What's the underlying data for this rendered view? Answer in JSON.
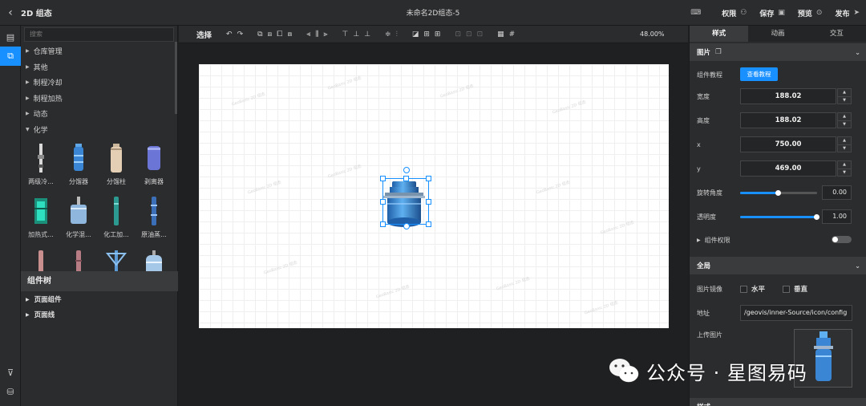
{
  "topbar": {
    "back_icon": "chevron-left-icon",
    "app_title": "2D 组态",
    "doc_title": "未命名2D组态-5",
    "actions": [
      {
        "label": "权限",
        "icon": "user-icon"
      },
      {
        "label": "保存",
        "icon": "save-icon"
      },
      {
        "label": "预览",
        "icon": "play-icon"
      },
      {
        "label": "发布",
        "icon": "send-icon"
      }
    ]
  },
  "rail": {
    "items": [
      "page-icon",
      "component-icon"
    ],
    "bottom": [
      "filter-icon",
      "database-icon"
    ]
  },
  "library": {
    "search_placeholder": "搜索",
    "categories": [
      "仓库管理",
      "其他",
      "制程冷却",
      "制程加热",
      "动态",
      "化学"
    ],
    "items_row1": [
      "两级冷...",
      "分馏器",
      "分馏柱",
      "剥离器"
    ],
    "items_row2": [
      "加热式...",
      "化学混...",
      "化工加...",
      "原油蒸..."
    ],
    "tree_header": "组件树",
    "tree_items": [
      "页面组件",
      "页面线"
    ]
  },
  "toolbar": {
    "select_label": "选择",
    "zoom": "48.00%"
  },
  "canvas": {
    "watermark": "GeoBasic 2D 组态"
  },
  "props": {
    "tabs": [
      "样式",
      "动画",
      "交互"
    ],
    "section_image": "图片",
    "tutorial_label": "组件教程",
    "tutorial_button": "查看教程",
    "width_label": "宽度",
    "width": "188.02",
    "height_label": "高度",
    "height": "188.02",
    "x_label": "x",
    "x": "750.00",
    "y_label": "y",
    "y": "469.00",
    "rotation_label": "旋转角度",
    "rotation": "0.00",
    "rotation_fraction": 0.5,
    "opacity_label": "透明度",
    "opacity": "1.00",
    "opacity_fraction": 1.0,
    "permission_label": "组件权限",
    "section_global": "全局",
    "mirror_label": "图片镜像",
    "mirror_h": "水平",
    "mirror_v": "垂直",
    "address_label": "地址",
    "address": "/geovis/inner-Source/icon/config",
    "upload_label": "上传图片",
    "section_style": "样式"
  },
  "watermark": {
    "text": "公众号 · 星图易码"
  },
  "colors": {
    "accent": "#1890ff",
    "panel": "#2b2c2e",
    "background": "#1f2021"
  }
}
